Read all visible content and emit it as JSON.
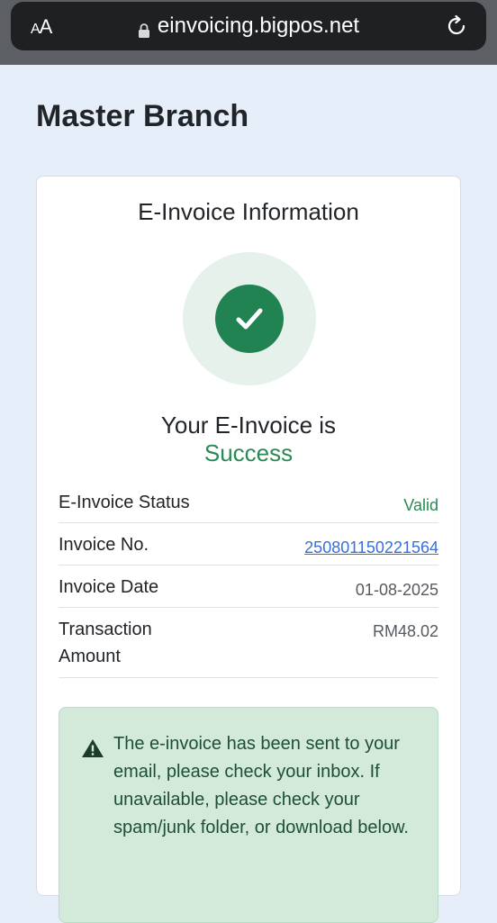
{
  "browser": {
    "text_size_label_small": "A",
    "text_size_label_large": "A",
    "url": "einvoicing.bigpos.net"
  },
  "page": {
    "title": "Master Branch"
  },
  "card": {
    "title": "E-Invoice Information",
    "status_prefix": "Your E-Invoice is",
    "status_value": "Success",
    "status_color": "#2a8a55",
    "rows": [
      {
        "label": "E-Invoice Status",
        "value": "Valid"
      },
      {
        "label": "Invoice No.",
        "value": "250801150221564"
      },
      {
        "label": "Invoice Date",
        "value": "01-08-2025"
      },
      {
        "label": "Transaction Amount",
        "value": "RM48.02"
      }
    ],
    "alert": {
      "icon": "warning-icon",
      "text": "The e-invoice has been sent to your email, please check your inbox. If unavailable, please check your spam/junk folder, or download below."
    }
  },
  "colors": {
    "accent_green": "#218252",
    "link_blue": "#3a6fd8",
    "alert_bg": "#d3eadb"
  }
}
